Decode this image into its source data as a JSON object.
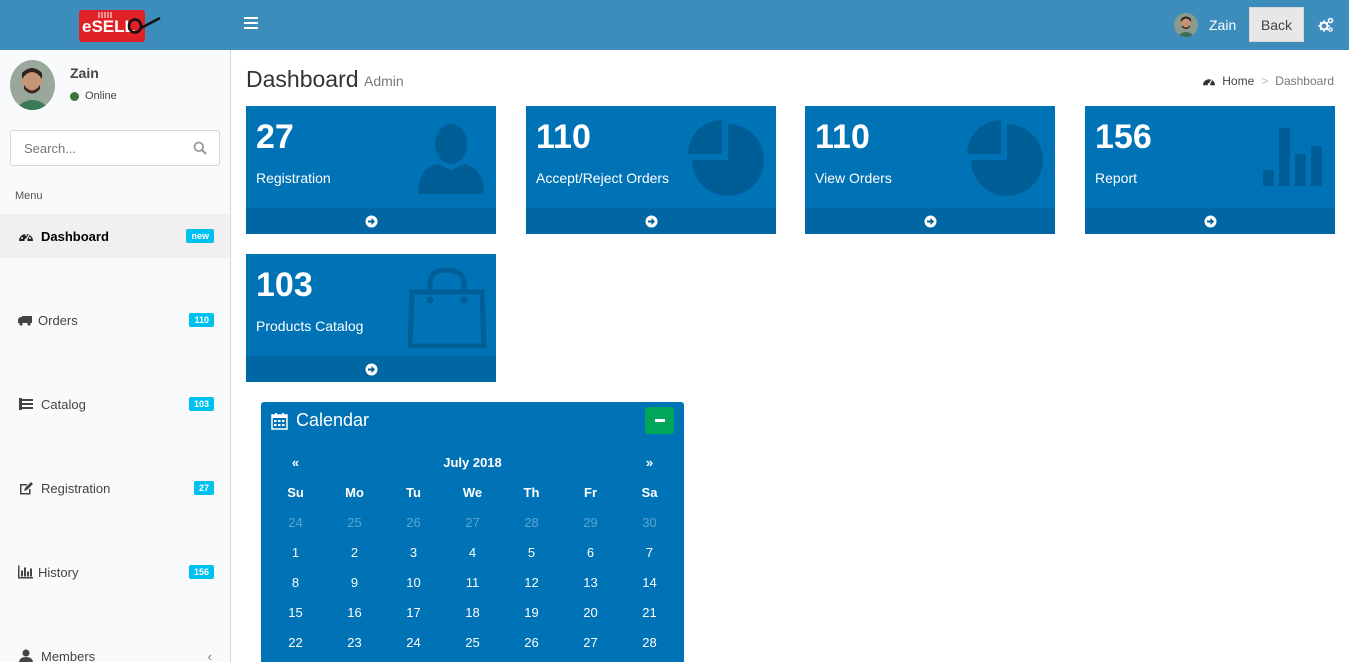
{
  "header": {
    "logo_text": "eSELL",
    "user_name": "Zain",
    "back_label": "Back"
  },
  "sidebar": {
    "user_name": "Zain",
    "status": "Online",
    "search_placeholder": "Search...",
    "menu_header": "Menu",
    "items": [
      {
        "label": "Dashboard",
        "badge": "new",
        "icon": "dashboard-icon"
      },
      {
        "label": "Orders",
        "badge": "110",
        "icon": "truck-icon"
      },
      {
        "label": "Catalog",
        "badge": "103",
        "icon": "list-icon"
      },
      {
        "label": "Registration",
        "badge": "27",
        "icon": "edit-icon"
      },
      {
        "label": "History",
        "badge": "156",
        "icon": "bar-chart-icon"
      },
      {
        "label": "Members",
        "badge": "",
        "icon": "user-icon"
      }
    ]
  },
  "page": {
    "title": "Dashboard",
    "subtitle": "Admin",
    "breadcrumb_home": "Home",
    "breadcrumb_current": "Dashboard"
  },
  "boxes": [
    {
      "value": "27",
      "label": "Registration",
      "icon": "user-icon"
    },
    {
      "value": "110",
      "label": "Accept/Reject Orders",
      "icon": "pie-chart-icon"
    },
    {
      "value": "110",
      "label": "View Orders",
      "icon": "pie-chart-icon"
    },
    {
      "value": "156",
      "label": "Report",
      "icon": "bar-chart-icon"
    },
    {
      "value": "103",
      "label": "Products Catalog",
      "icon": "shopping-bag-icon"
    }
  ],
  "calendar": {
    "title": "Calendar",
    "month": "July 2018",
    "prev": "«",
    "next": "»",
    "weekdays": [
      "Su",
      "Mo",
      "Tu",
      "We",
      "Th",
      "Fr",
      "Sa"
    ],
    "weeks": [
      [
        "24",
        "25",
        "26",
        "27",
        "28",
        "29",
        "30"
      ],
      [
        "1",
        "2",
        "3",
        "4",
        "5",
        "6",
        "7"
      ],
      [
        "8",
        "9",
        "10",
        "11",
        "12",
        "13",
        "14"
      ],
      [
        "15",
        "16",
        "17",
        "18",
        "19",
        "20",
        "21"
      ],
      [
        "22",
        "23",
        "24",
        "25",
        "26",
        "27",
        "28"
      ]
    ]
  },
  "colors": {
    "header": "#3c8dbc",
    "box": "#0073b7",
    "badge": "#00c0ef",
    "calendar_minimize": "#00a65a"
  }
}
